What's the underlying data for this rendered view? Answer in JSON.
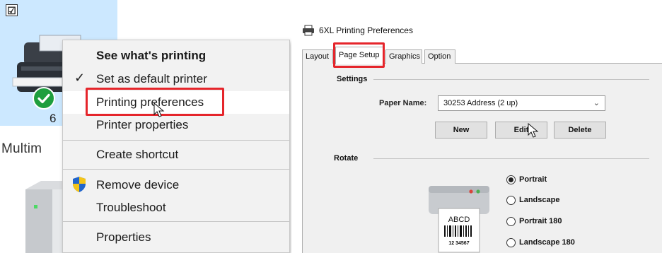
{
  "left": {
    "tile_checkbox_glyph": "☑",
    "tile_label": "6",
    "section_label": "Multim",
    "context_menu": {
      "items": [
        {
          "label": "See what's printing"
        },
        {
          "label": "Set as default printer",
          "check": "✓"
        },
        {
          "label": "Printing preferences"
        },
        {
          "label": "Printer properties"
        },
        {
          "label": "Create shortcut"
        },
        {
          "label": "Remove device",
          "icon": "uac-shield-icon"
        },
        {
          "label": "Troubleshoot"
        },
        {
          "label": "Properties"
        }
      ]
    }
  },
  "dialog": {
    "title": "6XL Printing Preferences",
    "title_icon": "printer-icon",
    "tabs": [
      {
        "label": "Layout"
      },
      {
        "label": "Page Setup"
      },
      {
        "label": "Graphics"
      },
      {
        "label": "Option"
      }
    ],
    "active_tab": "Page Setup",
    "settings": {
      "group_label": "Settings",
      "paper_name_label": "Paper Name:",
      "paper_name_value": "30253 Address (2 up)",
      "buttons": {
        "new": "New",
        "edit": "Edit",
        "delete": "Delete"
      }
    },
    "rotate": {
      "group_label": "Rotate",
      "preview_text": "ABCD",
      "preview_number": "12 34567",
      "options": [
        {
          "label": "Portrait",
          "checked": true
        },
        {
          "label": "Landscape",
          "checked": false
        },
        {
          "label": "Portrait 180",
          "checked": false
        },
        {
          "label": "Landscape 180",
          "checked": false
        }
      ]
    }
  },
  "colors": {
    "highlight_red": "#e5252b",
    "tile_selection": "#cce8ff",
    "menu_bg": "#f2f2f2",
    "dialog_bg": "#f0f0f0",
    "badge_green": "#1e9e3e",
    "shield_blue": "#2266cc",
    "shield_yellow": "#f5c518"
  }
}
